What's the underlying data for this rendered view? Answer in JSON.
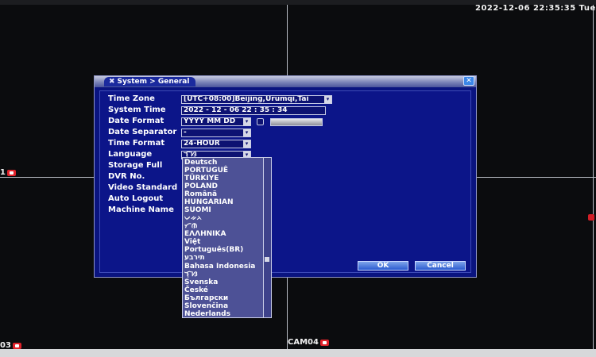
{
  "overlay": {
    "clock": "2022-12-06 22:35:35 Tue",
    "cam_labels": [
      "1",
      "CAM04",
      "03"
    ]
  },
  "dialog": {
    "title": "System > General",
    "close_label": "✕",
    "fields": [
      {
        "label": "Time Zone",
        "value": "[UTC+08:00]Beijing,Urumqi,Tai",
        "control": "dropdown"
      },
      {
        "label": "System Time",
        "value": "2022 - 12 - 06   22 : 35 : 34",
        "control": "input"
      },
      {
        "label": "Date Format",
        "value": "YYYY MM DD",
        "control": "dropdown"
      },
      {
        "label": "Date Separator",
        "value": "-",
        "control": "dropdown"
      },
      {
        "label": "Time Format",
        "value": "24-HOUR",
        "control": "dropdown"
      },
      {
        "label": "Language",
        "value": "ᜎᜓᜐ",
        "control": "dropdown"
      },
      {
        "label": "Storage Full",
        "value": "",
        "control": "hidden"
      },
      {
        "label": "DVR No.",
        "value": "",
        "control": "hidden"
      },
      {
        "label": "Video Standard",
        "value": "",
        "control": "hidden"
      },
      {
        "label": "Auto Logout",
        "value": "",
        "control": "hidden"
      },
      {
        "label": "Machine Name",
        "value": "",
        "control": "hidden"
      }
    ],
    "ok_label": "OK",
    "cancel_label": "Cancel",
    "language_options": [
      "Deutsch",
      "PORTUGUÊ",
      "TÜRKIYE",
      "POLAND",
      "Românã",
      "HUNGARIAN",
      "SUOMI",
      "ᨆᨀᨂ",
      "ᜆᜈ",
      "ΕΛΛΗΝΙΚΑ",
      "Việt",
      "Português(BR)",
      "תירבע",
      "Bahasa Indonesia",
      "ᜎᜓᜐ",
      "Svenska",
      "České",
      "Български",
      "Slovenčina",
      "Nederlands"
    ]
  },
  "colors": {
    "dialog_bg": "#0a1480",
    "accent": "#3b86e8",
    "list_bg": "#4d5196",
    "record_red": "#e0222a"
  }
}
